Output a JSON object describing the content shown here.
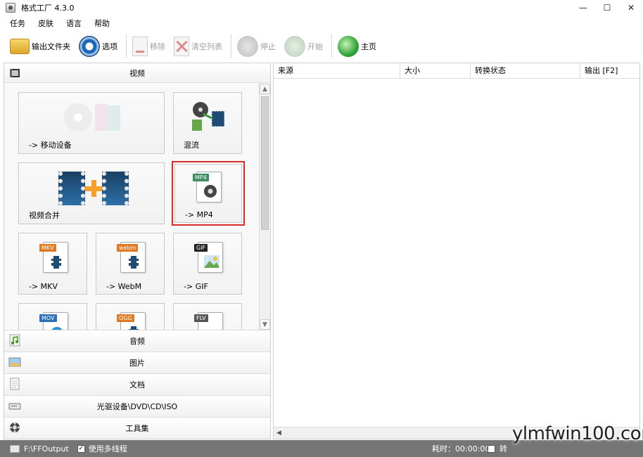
{
  "window": {
    "title": "格式工厂 4.3.0",
    "controls": [
      "—",
      "☐",
      "✕"
    ]
  },
  "menu": [
    "任务",
    "皮肤",
    "语言",
    "帮助"
  ],
  "toolbar": {
    "output_folder": "输出文件夹",
    "options": "选项",
    "remove": "移除",
    "clear_list": "清空列表",
    "stop": "停止",
    "start": "开始",
    "home": "主页"
  },
  "left_panel": {
    "category_video": "视频",
    "tiles": {
      "mobile": "-> 移动设备",
      "mux": "混流",
      "merge": "视频合并",
      "mp4": "-> MP4",
      "mkv": "-> MKV",
      "webm": "-> WebM",
      "gif": "-> GIF"
    },
    "badges": {
      "mp4": "MP4",
      "mkv": "MKV",
      "webm": "webm",
      "gif": "GIF",
      "mov": "MOV",
      "ogg": "OGG",
      "flv": "FLV"
    },
    "categories": [
      "音频",
      "图片",
      "文档",
      "光驱设备\\DVD\\CD\\ISO",
      "工具集"
    ]
  },
  "task_list": {
    "columns": [
      "来源",
      "大小",
      "转换状态",
      "输出 [F2]"
    ]
  },
  "status_bar": {
    "output_path": "F:\\FFOutput",
    "multithread_label": "使用多线程",
    "elapsed": "耗时：00:00:00",
    "after_convert": "转"
  },
  "watermark": "ylmfwin100.com",
  "colors": {
    "selection_border": "#d62c2c",
    "status_bar_bg": "#757575"
  }
}
